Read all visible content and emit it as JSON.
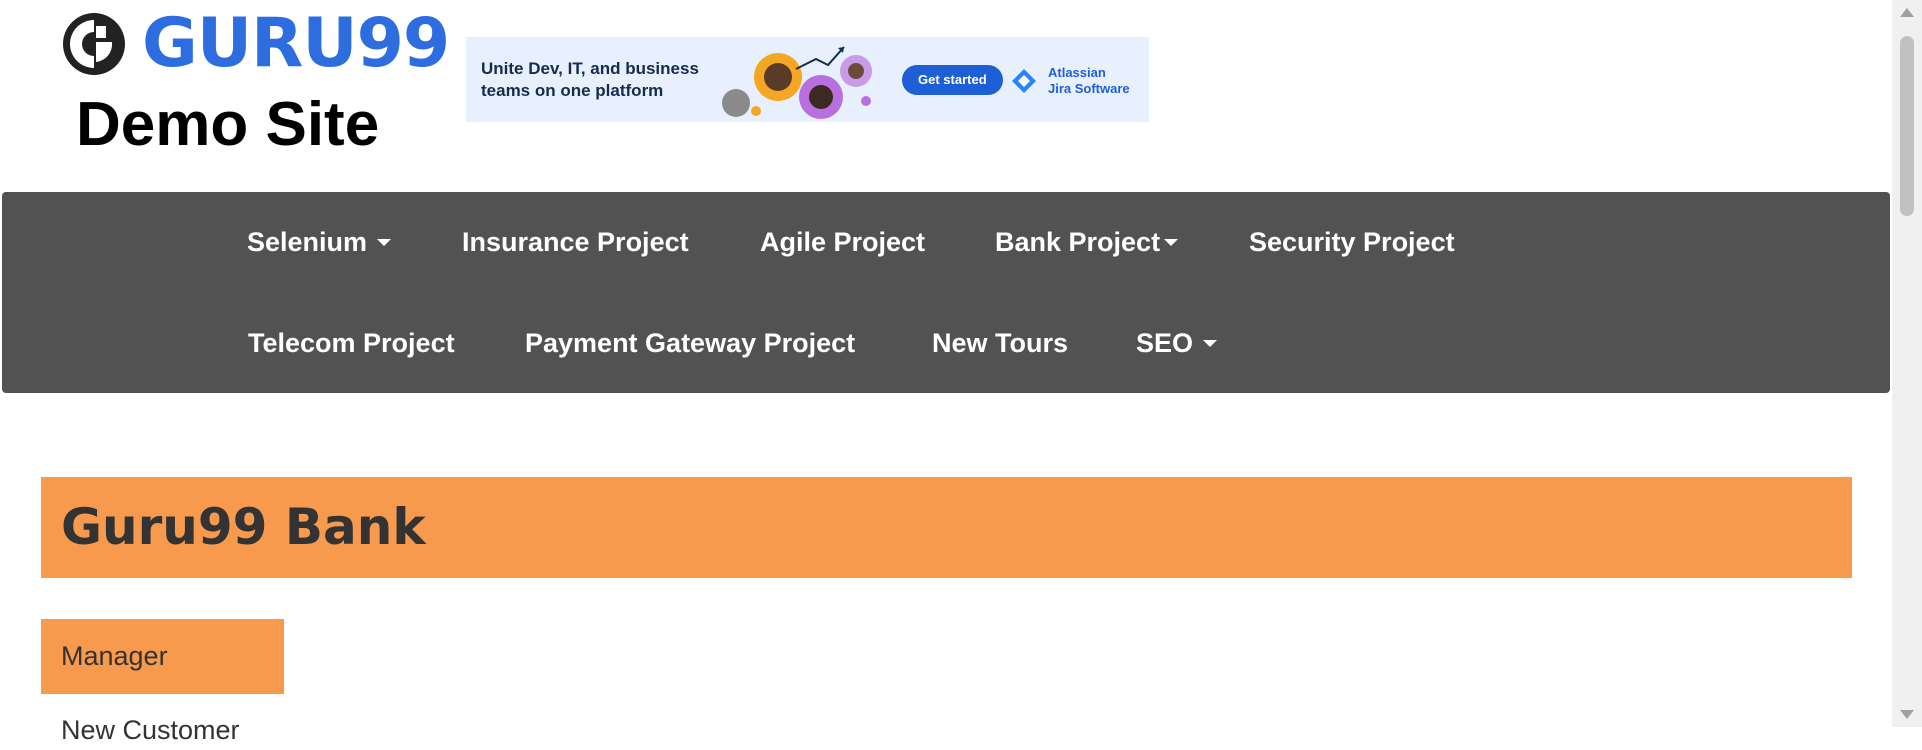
{
  "header": {
    "logo_text": "GURU99",
    "logo_subtitle": "Demo Site",
    "logo_icon": "guru99-logo-icon"
  },
  "banner": {
    "text": "Unite Dev, IT, and business teams on one platform",
    "button_label": "Get started",
    "brand_line1": "Atlassian",
    "brand_line2": "Jira Software"
  },
  "nav": {
    "row1": [
      {
        "label": "Selenium",
        "dropdown": true
      },
      {
        "label": "Insurance Project",
        "dropdown": false
      },
      {
        "label": "Agile Project",
        "dropdown": false
      },
      {
        "label": "Bank Project",
        "dropdown": true
      },
      {
        "label": "Security Project",
        "dropdown": false
      }
    ],
    "row2": [
      {
        "label": "Telecom Project",
        "dropdown": false
      },
      {
        "label": "Payment Gateway Project",
        "dropdown": false
      },
      {
        "label": "New Tours",
        "dropdown": false
      },
      {
        "label": "SEO",
        "dropdown": true
      }
    ]
  },
  "main": {
    "title": "Guru99 Bank",
    "sidebar_heading": "Manager",
    "sidebar_items": [
      "New Customer"
    ]
  },
  "colors": {
    "nav_bg": "#525252",
    "accent_orange": "#f79a4e",
    "logo_blue": "#2e6de0",
    "text_dark": "#333333"
  }
}
